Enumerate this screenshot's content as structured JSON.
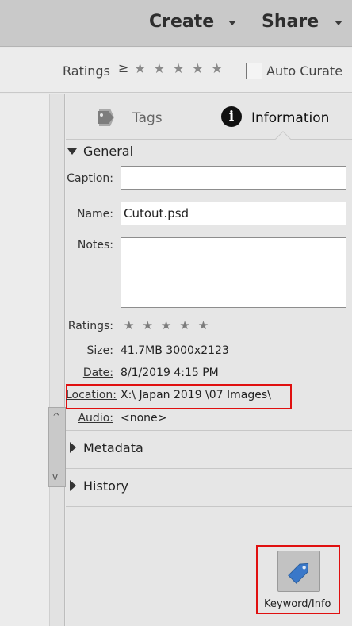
{
  "topbar": {
    "create_label": "Create",
    "share_label": "Share"
  },
  "ratings_bar": {
    "label": "Ratings",
    "comparator": "≥",
    "stars": "★★★★★",
    "auto_curate_label": "Auto Curate"
  },
  "tabs": {
    "tags_label": "Tags",
    "information_label": "Information"
  },
  "general": {
    "title": "General",
    "caption_label": "Caption:",
    "caption_value": "",
    "name_label": "Name:",
    "name_value": "Cutout.psd",
    "notes_label": "Notes:",
    "notes_value": "",
    "ratings_label": "Ratings:",
    "ratings_stars": "★★★★★",
    "size_label": "Size:",
    "size_value": "41.7MB  3000x2123",
    "date_label": "Date:",
    "date_value": "8/1/2019 4:15 PM",
    "location_label": "Location:",
    "location_value": "X:\\ Japan 2019 \\07 Images\\",
    "audio_label": "Audio:",
    "audio_value": "<none>"
  },
  "sections": {
    "metadata_label": "Metadata",
    "history_label": "History"
  },
  "scroll": {
    "up": "^",
    "down": "v"
  },
  "keyword_info": {
    "label": "Keyword/Info"
  },
  "colors": {
    "highlight": "#e01010",
    "tag_icon": "#3a78c9"
  }
}
